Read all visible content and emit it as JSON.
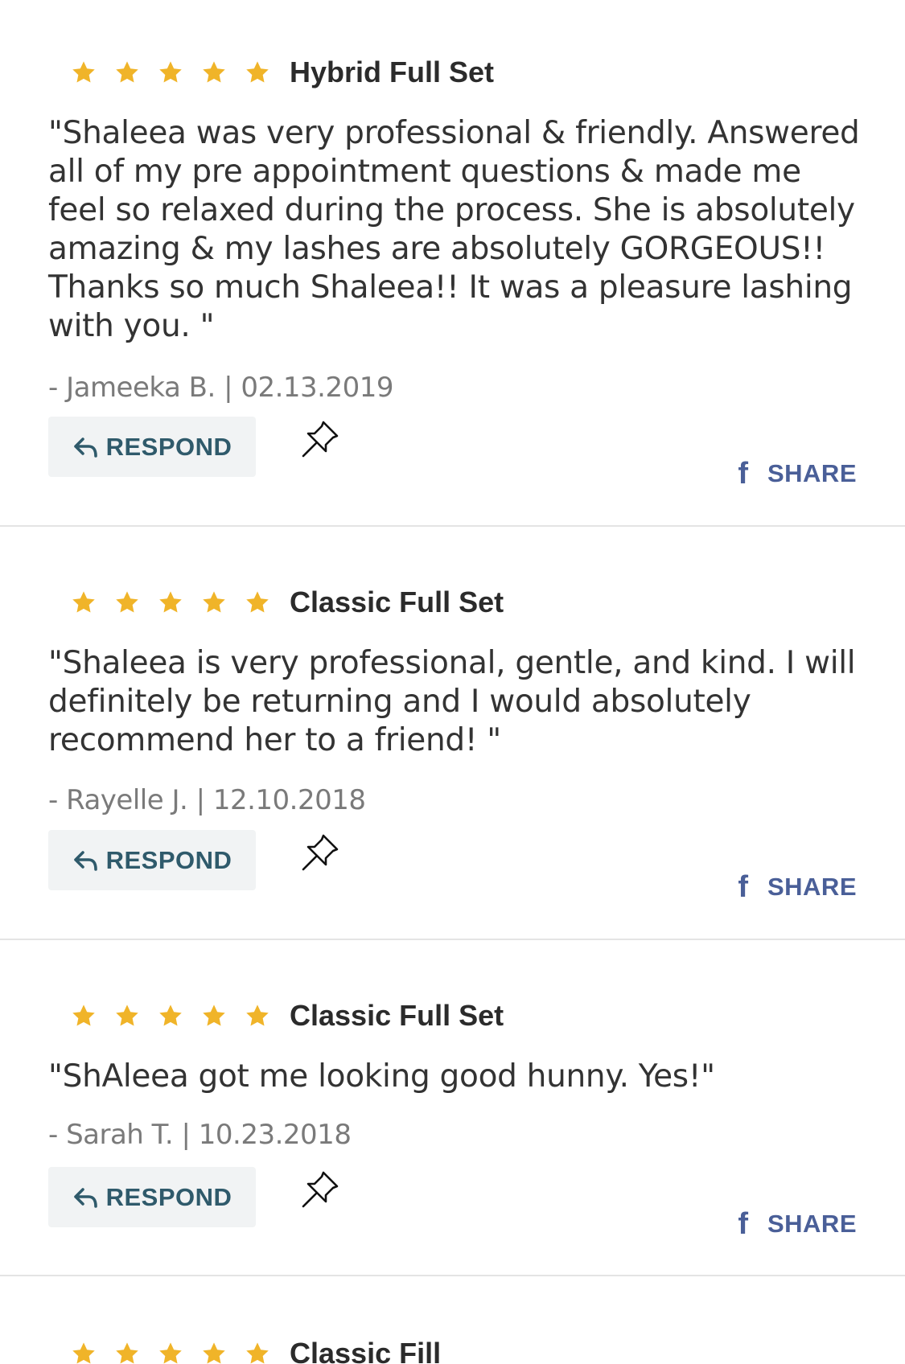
{
  "colors": {
    "star": "#f0b429",
    "respond_text": "#2f5a6b",
    "share_text": "#4a5f98",
    "divider": "#e4e4e4"
  },
  "reviews": [
    {
      "rating": 5,
      "service": "Hybrid Full Set",
      "text": "\"Shaleea was very professional & friendly. Answered all of my pre appointment questions & made me feel so relaxed during the process. She is absolutely amazing & my lashes are absolutely GORGEOUS!! Thanks so much Shaleea!! It was a pleasure lashing with you. \"",
      "meta": "- Jameeka B. | 02.13.2019",
      "respond_label": "RESPOND",
      "share_label": "SHARE",
      "share_icon": "f"
    },
    {
      "rating": 5,
      "service": "Classic Full Set",
      "text": "\"Shaleea is very professional, gentle, and kind. I will definitely be returning and I would absolutely recommend her to a friend! \"",
      "meta": "- Rayelle J. | 12.10.2018",
      "respond_label": "RESPOND",
      "share_label": "SHARE",
      "share_icon": "f"
    },
    {
      "rating": 5,
      "service": "Classic Full Set",
      "text": "\"ShAleea got me looking good hunny. Yes!\"",
      "meta": "- Sarah T. | 10.23.2018",
      "respond_label": "RESPOND",
      "share_label": "SHARE",
      "share_icon": "f"
    },
    {
      "rating": 5,
      "service": "Classic Fill"
    }
  ]
}
